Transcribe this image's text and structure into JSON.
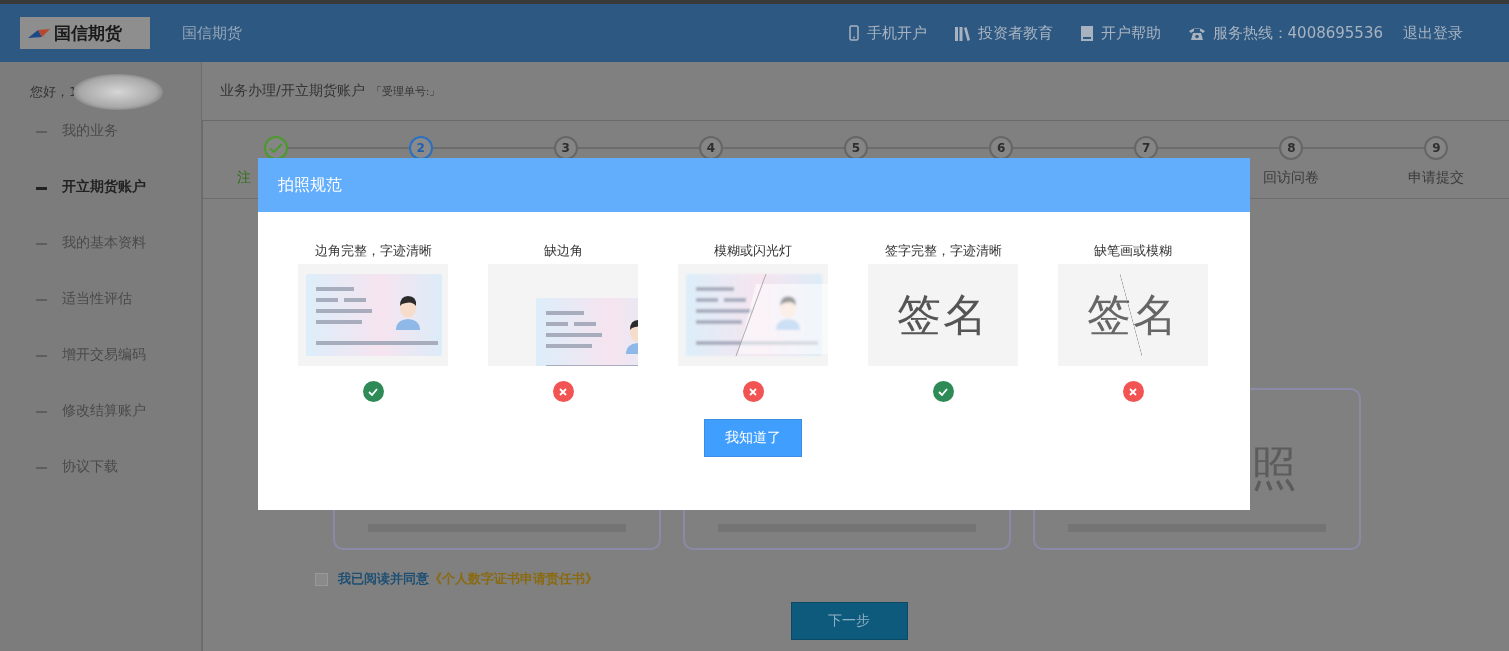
{
  "header": {
    "logo": "国信期货",
    "site_name": "国信期货",
    "nav": [
      {
        "kind": "mobile",
        "label": "手机开户"
      },
      {
        "kind": "books",
        "label": "投资者教育"
      },
      {
        "kind": "book",
        "label": "开户帮助"
      },
      {
        "kind": "phone",
        "label": "服务热线：4008695536"
      },
      {
        "kind": "plain",
        "label": "退出登录"
      }
    ]
  },
  "sidebar": {
    "greeting": "您好，1",
    "items": [
      {
        "label": "我的业务",
        "selected": false
      },
      {
        "label": "开立期货账户",
        "selected": true
      },
      {
        "label": "我的基本资料",
        "selected": false
      },
      {
        "label": "适当性评估",
        "selected": false
      },
      {
        "label": "增开交易编码",
        "selected": false
      },
      {
        "label": "修改结算账户",
        "selected": false
      },
      {
        "label": "协议下载",
        "selected": false
      }
    ]
  },
  "breadcrumb": {
    "path": "业务办理/开立期货账户",
    "order_no": "「受理单号:」"
  },
  "steps": [
    {
      "completed": true,
      "selected": false,
      "label": "注"
    },
    {
      "completed": false,
      "selected": true,
      "number": "2"
    },
    {
      "completed": false,
      "selected": false,
      "number": "3"
    },
    {
      "completed": false,
      "selected": false,
      "number": "4"
    },
    {
      "completed": false,
      "selected": false,
      "number": "5"
    },
    {
      "completed": false,
      "selected": false,
      "number": "6"
    },
    {
      "completed": false,
      "selected": false,
      "number": "7"
    },
    {
      "completed": false,
      "selected": false,
      "number": "8",
      "label": "回访问卷"
    },
    {
      "completed": false,
      "selected": false,
      "number": "9",
      "label": "申请提交"
    }
  ],
  "upload_cards": [
    {
      "kind": "blank"
    },
    {
      "kind": "blank"
    },
    {
      "kind": "text",
      "watermark": "照"
    }
  ],
  "agreement": {
    "checked": false,
    "text": "我已阅读并同意",
    "link": "《个人数字证书申请责任书》"
  },
  "next_button": "下一步",
  "modal": {
    "title": "拍照规范",
    "button": "我知道了",
    "examples": [
      {
        "caption": "边角完整，字迹清晰",
        "kind": "id_card",
        "ok": true
      },
      {
        "caption": "缺边角",
        "kind": "id_card_cropped",
        "ok": false
      },
      {
        "caption": "模糊或闪光灯",
        "kind": "id_card_glare",
        "ok": false
      },
      {
        "caption": "签字完整，字迹清晰",
        "kind": "signature",
        "sample": "签名",
        "ok": true
      },
      {
        "caption": "缺笔画或模糊",
        "kind": "signature_split",
        "sample": "签名",
        "ok": false
      }
    ]
  }
}
